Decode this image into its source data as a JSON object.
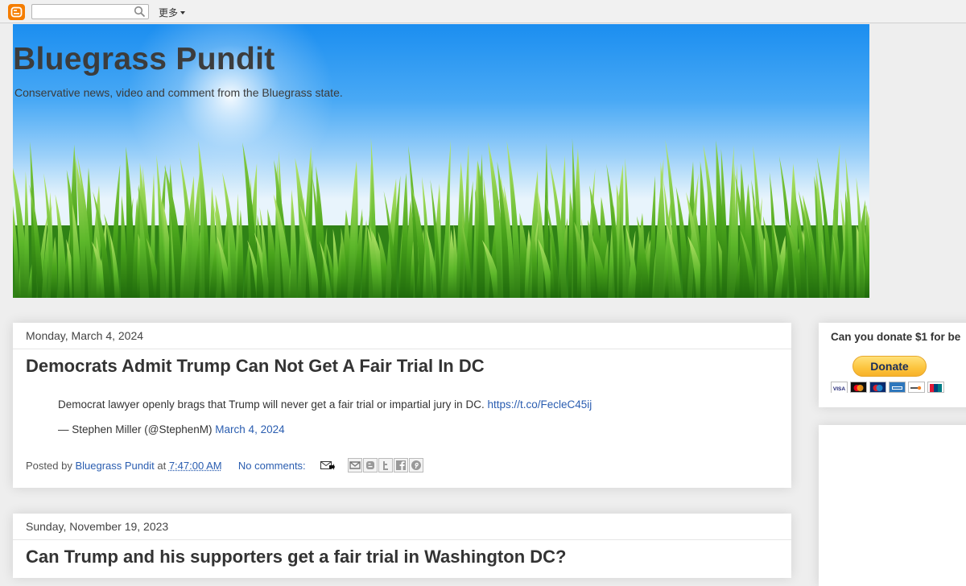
{
  "navbar": {
    "more_label": "更多",
    "search_placeholder": ""
  },
  "header": {
    "title": "Bluegrass Pundit",
    "description": "Conservative news, video and comment from the Bluegrass state."
  },
  "posts": [
    {
      "date": "Monday, March 4, 2024",
      "title": "Democrats Admit Trump Can Not Get A Fair Trial In DC",
      "tweet_text": "Democrat lawyer openly brags that Trump will never get a fair trial or impartial jury in DC.",
      "tweet_link": "https://t.co/FecleC45ij",
      "tweet_author": "— Stephen Miller (@StephenM)",
      "tweet_date": "March 4, 2024",
      "posted_by_label": "Posted by",
      "author": "Bluegrass Pundit",
      "at_label": "at",
      "time": "7:47:00 AM",
      "comments": "No comments:"
    },
    {
      "date": "Sunday, November 19, 2023",
      "title": "Can Trump and his supporters get a fair trial in Washington DC?"
    }
  ],
  "sidebar": {
    "donate_title": "Can you donate $1 for be",
    "donate_button": "Donate"
  },
  "colors": {
    "link": "#2a5db0",
    "background": "#eeeeee",
    "blogger_orange": "#f57d00",
    "paypal_yellow": "#fcc43d"
  }
}
